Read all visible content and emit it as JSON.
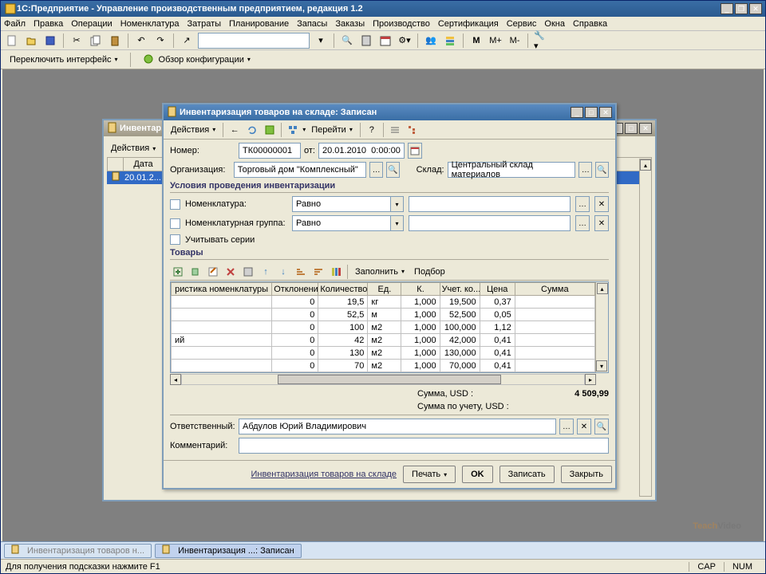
{
  "app": {
    "title": "1С:Предприятие - Управление производственным предприятием, редакция 1.2"
  },
  "menubar": [
    "Файл",
    "Правка",
    "Операции",
    "Номенклатура",
    "Затраты",
    "Планирование",
    "Запасы",
    "Заказы",
    "Производство",
    "Сертификация",
    "Сервис",
    "Окна",
    "Справка"
  ],
  "toolbar2": {
    "switch_interface": "Переключить интерфейс",
    "config_overview": "Обзор конфигурации"
  },
  "bg_window": {
    "title": "Инвентар...",
    "actions": "Действия",
    "col_date": "Дата",
    "row_date": "20.01.2..."
  },
  "dlg": {
    "title": "Инвентаризация товаров на складе: Записан",
    "actions": "Действия",
    "goto": "Перейти",
    "number_label": "Номер:",
    "number": "ТК00000001",
    "date_label": "от:",
    "date": "20.01.2010  0:00:00",
    "org_label": "Организация:",
    "org": "Торговый дом \"Комплексный\"",
    "warehouse_label": "Склад:",
    "warehouse": "Центральный склад материалов",
    "conditions_header": "Условия проведения инвентаризации",
    "nomenclature_label": "Номенклатура:",
    "nomenclature_group_label": "Номенклатурная группа:",
    "equal": "Равно",
    "account_series": "Учитывать серии",
    "goods_header": "Товары",
    "fill": "Заполнить",
    "pick": "Подбор",
    "columns": {
      "char": "ристика номенклатуры",
      "deviation": "Отклонение",
      "qty": "Количество",
      "unit": "Ед.",
      "k": "К.",
      "acc_qty": "Учет. ко...",
      "price": "Цена",
      "sum": "Сумма"
    },
    "rows": [
      {
        "char": "",
        "dev": "0",
        "qty": "19,5",
        "unit": "кг",
        "k": "1,000",
        "acc": "19,500",
        "price": "0,37"
      },
      {
        "char": "",
        "dev": "0",
        "qty": "52,5",
        "unit": "м",
        "k": "1,000",
        "acc": "52,500",
        "price": "0,05"
      },
      {
        "char": "",
        "dev": "0",
        "qty": "100",
        "unit": "м2",
        "k": "1,000",
        "acc": "100,000",
        "price": "1,12"
      },
      {
        "char": "ий",
        "dev": "0",
        "qty": "42",
        "unit": "м2",
        "k": "1,000",
        "acc": "42,000",
        "price": "0,41"
      },
      {
        "char": "",
        "dev": "0",
        "qty": "130",
        "unit": "м2",
        "k": "1,000",
        "acc": "130,000",
        "price": "0,41"
      },
      {
        "char": "",
        "dev": "0",
        "qty": "70",
        "unit": "м2",
        "k": "1,000",
        "acc": "70,000",
        "price": "0,41"
      }
    ],
    "total_usd_label": "Сумма, USD :",
    "total_usd": "4 509,99",
    "total_acc_label": "Сумма по учету, USD :",
    "responsible_label": "Ответственный:",
    "responsible": "Абдулов Юрий Владимирович",
    "comment_label": "Комментарий:",
    "footer_link": "Инвентаризация товаров на складе",
    "print": "Печать",
    "ok": "OK",
    "save": "Записать",
    "close": "Закрыть"
  },
  "taskbar": {
    "item1": "Инвентаризация товаров н...",
    "item2": "Инвентаризация ...: Записан"
  },
  "status": {
    "hint": "Для получения подсказки нажмите F1",
    "cap": "CAP",
    "num": "NUM"
  },
  "watermark": {
    "a": "Teach",
    "b": "Video"
  }
}
